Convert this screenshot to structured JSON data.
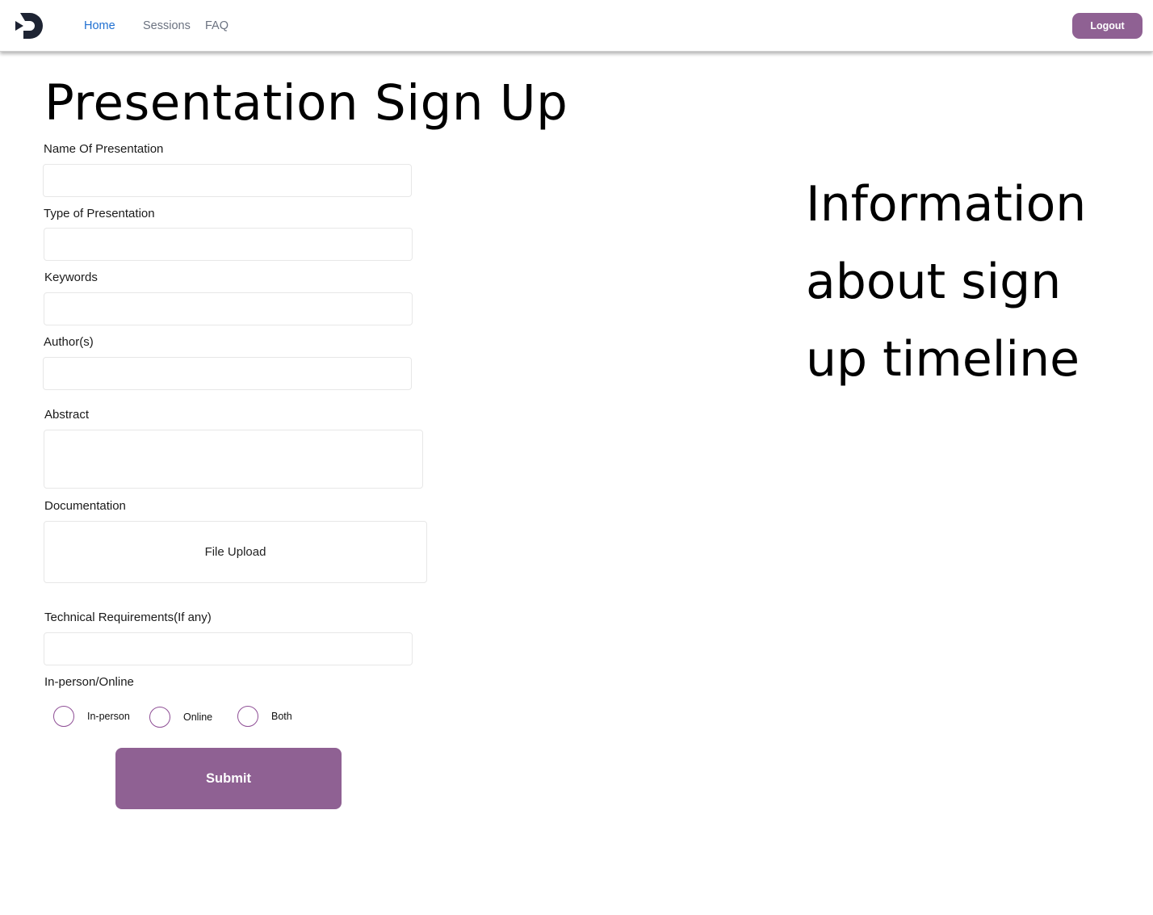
{
  "nav": {
    "logo_icon": "d-logo-icon",
    "links": [
      "Home",
      "Sessions",
      "FAQ"
    ],
    "active": "Home",
    "logout_label": "Logout"
  },
  "page": {
    "title": "Presentation Sign Up"
  },
  "form": {
    "name_label": "Name Of Presentation",
    "name_value": "",
    "type_label": "Type of Presentation",
    "type_value": "",
    "keywords_label": "Keywords",
    "keywords_value": "",
    "authors_label": "Author(s)",
    "authors_value": "",
    "abstract_label": "Abstract",
    "abstract_value": "",
    "documentation_label": "Documentation",
    "upload_label": "File Upload",
    "tech_label": "Technical Requirements(If any)",
    "tech_value": "",
    "mode_label": "In-person/Online",
    "mode_options": [
      "In-person",
      "Online",
      "Both"
    ],
    "mode_selected": "",
    "submit_label": "Submit"
  },
  "info": {
    "text": "Information about sign up timeline"
  },
  "colors": {
    "accent": "#8f6193",
    "nav_active": "#1f6fd1",
    "nav_inactive": "#6b7280"
  }
}
